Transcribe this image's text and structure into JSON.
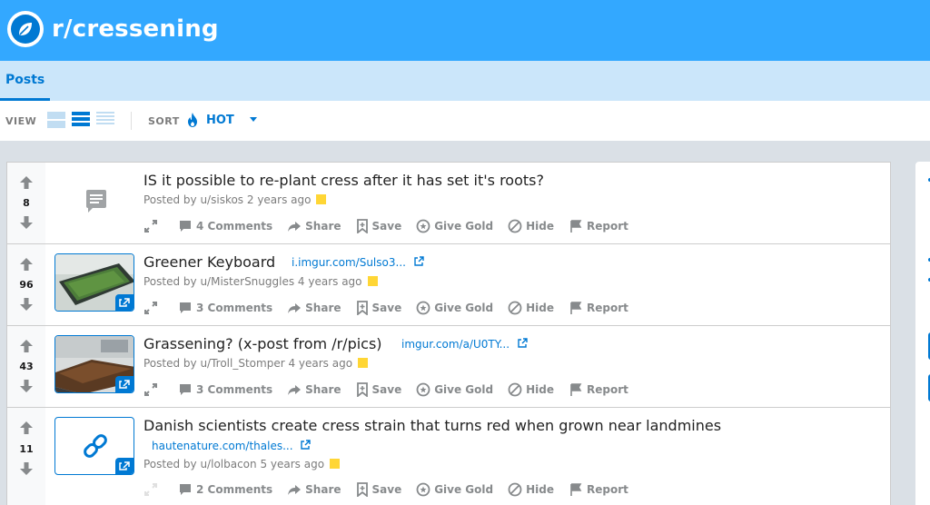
{
  "subreddit": {
    "name": "r/cressening",
    "icon": "subreddit-leaf-icon"
  },
  "tabs": [
    {
      "label": "Posts",
      "active": true
    }
  ],
  "toolbar": {
    "view_label": "VIEW",
    "view_modes": [
      "card-view-icon",
      "classic-view-icon",
      "compact-view-icon"
    ],
    "active_view": "classic-view-icon",
    "sort_label": "SORT",
    "sort_value": "HOT",
    "sort_icon": "flame-icon"
  },
  "colors": {
    "brand_blue": "#0079d3",
    "header_blue": "#33a8ff",
    "tab_bar": "#cbe6fa",
    "flag_yellow": "#ffd635"
  },
  "actions": {
    "share": "Share",
    "save": "Save",
    "give_gold": "Give Gold",
    "hide": "Hide",
    "report": "Report"
  },
  "posts": [
    {
      "score": "8",
      "title": "IS it possible to re-plant cress after it has set it's roots?",
      "domain": "",
      "meta": "Posted by u/siskos 2 years ago",
      "comments": "4 Comments",
      "thumb": "self-post-icon"
    },
    {
      "score": "96",
      "title": "Greener Keyboard",
      "domain": "i.imgur.com/Sulso3...",
      "meta": "Posted by u/MisterSnuggles 4 years ago",
      "comments": "3 Comments",
      "thumb": "keyboard-photo"
    },
    {
      "score": "43",
      "title": "Grassening? (x-post from /r/pics)",
      "domain": "imgur.com/a/U0TY...",
      "meta": "Posted by u/Troll_Stomper 4 years ago",
      "comments": "3 Comments",
      "thumb": "desk-photo"
    },
    {
      "score": "11",
      "title": "Danish scientists create cress strain that turns red when grown near landmines",
      "domain": "hautenature.com/thales...",
      "meta": "Posted by u/lolbacon 5 years ago",
      "comments": "2 Comments",
      "thumb": "link-icon"
    }
  ]
}
